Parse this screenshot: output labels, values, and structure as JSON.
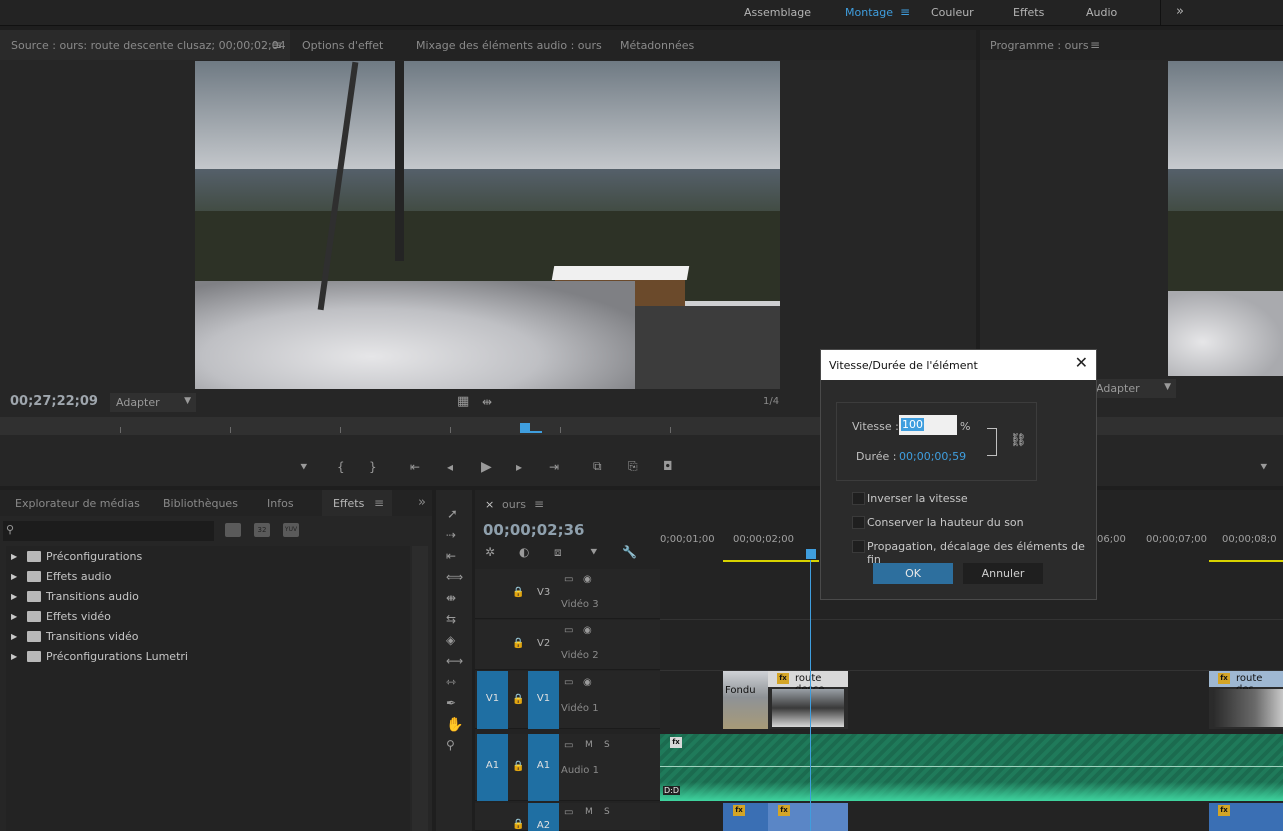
{
  "workspaces": {
    "assembly": "Assemblage",
    "editing": "Montage",
    "color": "Couleur",
    "effects": "Effets",
    "audio": "Audio",
    "more": "»"
  },
  "source_panel": {
    "tab_source": "Source : ours: route descente clusaz; 00;00;02;04",
    "tab_effect_options": "Options d'effet",
    "tab_audio_mixer": "Mixage des éléments audio : ours",
    "tab_metadata": "Métadonnées",
    "timecode": "00;27;22;09",
    "fit": "Adapter",
    "resolution": "1/4"
  },
  "program_panel": {
    "tab_program": "Programme : ours",
    "fit": "Adapter"
  },
  "project_panel": {
    "tab_media_browser": "Explorateur de médias",
    "tab_libraries": "Bibliothèques",
    "tab_info": "Infos",
    "tab_effects": "Effets",
    "more": "»",
    "filter_badges": [
      "32",
      "YUV"
    ],
    "items": [
      {
        "label": "Préconfigurations",
        "icon": "preset-folder-icon"
      },
      {
        "label": "Effets audio",
        "icon": "folder-icon"
      },
      {
        "label": "Transitions audio",
        "icon": "folder-icon"
      },
      {
        "label": "Effets vidéo",
        "icon": "folder-icon"
      },
      {
        "label": "Transitions vidéo",
        "icon": "folder-icon"
      },
      {
        "label": "Préconfigurations Lumetri",
        "icon": "preset-folder-icon"
      }
    ]
  },
  "timeline": {
    "tab_close": "×",
    "tab_name": "ours",
    "timecode": "00;00;02;36",
    "ruler": [
      "0;00;01;00",
      "00;00;02;00",
      "06;00",
      "00;00;07;00",
      "00;00;08;0"
    ],
    "tracks": [
      {
        "id": "V3",
        "name": "Vidéo 3"
      },
      {
        "id": "V2",
        "name": "Vidéo 2"
      },
      {
        "id": "V1",
        "name": "Vidéo 1",
        "src": "V1"
      },
      {
        "id": "A1",
        "name": "Audio 1",
        "src": "A1",
        "m": "M",
        "s": "S"
      },
      {
        "id": "A2",
        "name": "",
        "m": "M",
        "s": "S"
      }
    ],
    "clips": {
      "fondu": "Fondu",
      "route1": "route desce",
      "route2": "route des",
      "fx": "fx",
      "dd": "D:D"
    }
  },
  "dialog": {
    "title": "Vitesse/Durée de l'élément",
    "speed_label": "Vitesse :",
    "speed_value": "100",
    "percent": "%",
    "duration_label": "Durée :",
    "duration_value": "00;00;00;59",
    "reverse": "Inverser la vitesse",
    "keep_pitch": "Conserver la hauteur du son",
    "ripple": "Propagation, décalage des éléments de fin",
    "ok": "OK",
    "cancel": "Annuler"
  },
  "colors": {
    "accent": "#3f9ede",
    "track_blue": "#1f6fa3",
    "audio_green": "#1f7a5a",
    "fx_badge": "#d4a526",
    "ok_button": "#2d6f9e"
  }
}
